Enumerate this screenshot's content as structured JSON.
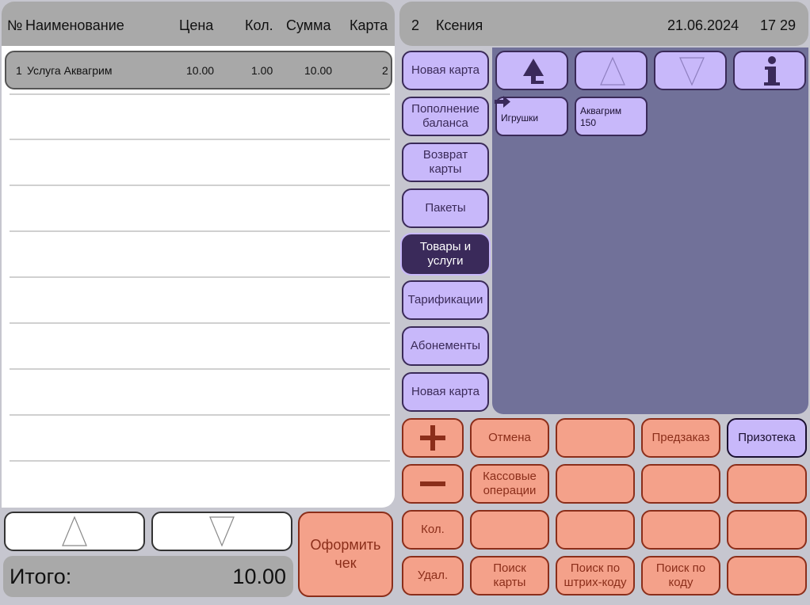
{
  "receipt": {
    "headers": {
      "num": "№",
      "name": "Наименование",
      "price": "Цена",
      "qty": "Кол.",
      "sum": "Сумма",
      "card": "Карта"
    },
    "rows": [
      {
        "num": "1",
        "name": "Услуга Аквагрим",
        "price": "10.00",
        "qty": "1.00",
        "sum": "10.00",
        "card": "2"
      }
    ],
    "total_label": "Итого:",
    "total_value": "10.00",
    "checkout_label": "Оформить чек"
  },
  "header": {
    "operator_id": "2",
    "operator_name": "Ксения",
    "date": "21.06.2024",
    "time": "17 29"
  },
  "categories": [
    {
      "label": "Новая карта"
    },
    {
      "label": "Пополнение баланса"
    },
    {
      "label": "Возврат карты"
    },
    {
      "label": "Пакеты"
    },
    {
      "label": "Товары и услуги",
      "active": true
    },
    {
      "label": "Тарификации"
    },
    {
      "label": "Абонементы"
    },
    {
      "label": "Новая карта"
    }
  ],
  "tiles": [
    {
      "label": "Игрушки",
      "type": "folder"
    },
    {
      "label": "Аквагрим 150",
      "type": "item"
    }
  ],
  "keypad": {
    "cancel": "Отмена",
    "preorder": "Предзаказ",
    "prize": "Призотека",
    "cash_ops": "Кассовые операции",
    "qty": "Кол.",
    "delete": "Удал.",
    "search_card": "Поиск карты",
    "search_barcode": "Поиск по штрих-коду",
    "search_code": "Поиск по коду"
  },
  "colors": {
    "accent_lavender": "#c8b8fa",
    "accent_salmon": "#f4a18a",
    "panel_slate": "#717199",
    "dark_purple": "#3a2a5a"
  },
  "icons": [
    "up-root-icon",
    "arrow-up-icon",
    "arrow-down-icon",
    "info-icon",
    "folder-arrow-icon",
    "plus-icon",
    "minus-icon"
  ]
}
